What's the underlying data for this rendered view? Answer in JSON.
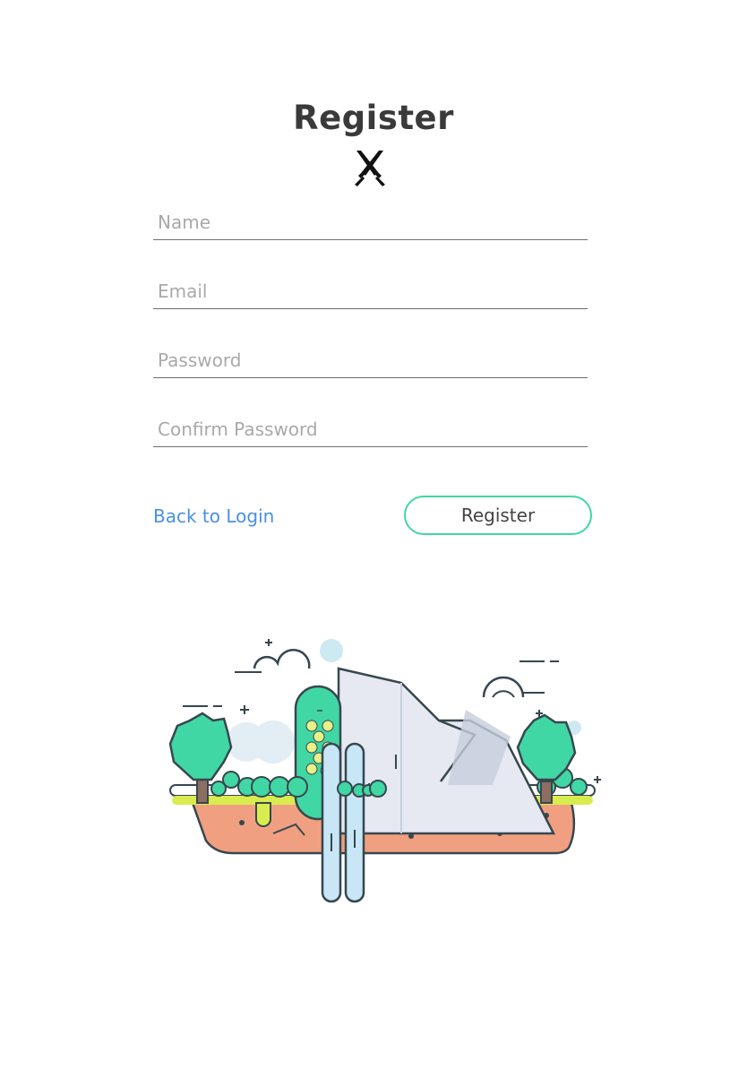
{
  "header": {
    "title": "Register",
    "icon": "crossed-swords-icon"
  },
  "form": {
    "name_placeholder": "Name",
    "email_placeholder": "Email",
    "password_placeholder": "Password",
    "confirm_password_placeholder": "Confirm Password"
  },
  "actions": {
    "back_label": "Back to Login",
    "register_label": "Register"
  },
  "illustration": {
    "icon": "floating-island-illustration"
  },
  "colors": {
    "title": "#3a3a3a",
    "link": "#4a90e2",
    "button_border": "#40d7a4",
    "placeholder": "#a9a9a9"
  }
}
